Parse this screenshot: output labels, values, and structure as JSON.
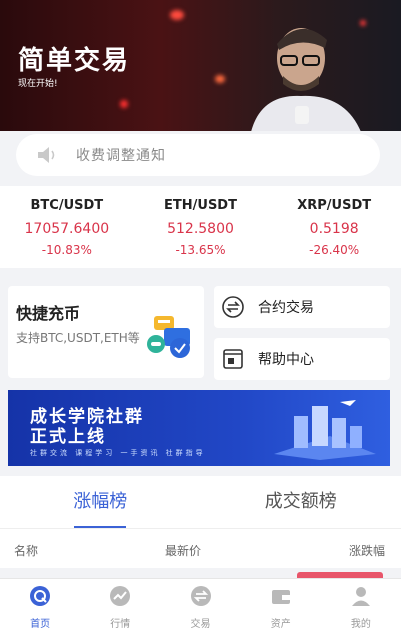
{
  "banner": {
    "title": "简单交易",
    "subtitle": "现在开始!"
  },
  "notice": {
    "text": "收费调整通知",
    "icon": "speaker-icon"
  },
  "tickers": [
    {
      "pair": "BTC/USDT",
      "price": "17057.6400",
      "change": "-10.83%"
    },
    {
      "pair": "ETH/USDT",
      "price": "512.5800",
      "change": "-13.65%"
    },
    {
      "pair": "XRP/USDT",
      "price": "0.5198",
      "change": "-26.40%"
    }
  ],
  "quick": {
    "deposit_title": "快捷充币",
    "deposit_desc": "支持BTC,USDT,ETH等",
    "contract": "合约交易",
    "help": "帮助中心"
  },
  "promo": {
    "line1": "成长学院社群",
    "line2": "正式上线",
    "line3": "社群交流  课程学习  一手资讯  社群指导"
  },
  "tabs": {
    "gainers": "涨幅榜",
    "volume": "成交额榜"
  },
  "table": {
    "col_name": "名称",
    "col_price": "最新价",
    "col_change": "涨跌幅"
  },
  "nav": [
    {
      "label": "首页",
      "icon": "home-icon"
    },
    {
      "label": "行情",
      "icon": "market-icon"
    },
    {
      "label": "交易",
      "icon": "trade-icon"
    },
    {
      "label": "资产",
      "icon": "wallet-icon"
    },
    {
      "label": "我的",
      "icon": "profile-icon"
    }
  ],
  "colors": {
    "accent": "#3b62d6",
    "down": "#d9344a"
  }
}
